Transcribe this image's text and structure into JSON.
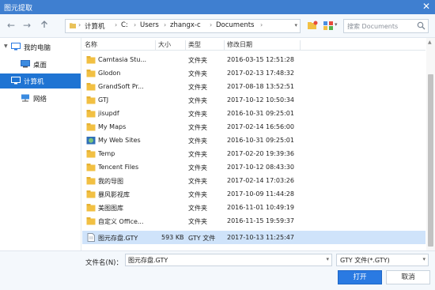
{
  "window": {
    "title": "图元提取",
    "close_label": "✕"
  },
  "address_bar": {
    "crumbs": [
      "计算机",
      "C:",
      "Users",
      "zhangx-c",
      "Documents"
    ]
  },
  "search": {
    "placeholder": "搜索 Documents"
  },
  "sidebar": {
    "items": [
      {
        "label": "我的电脑",
        "icon": "monitor-icon"
      },
      {
        "label": "桌面",
        "icon": "desktop-icon"
      },
      {
        "label": "计算机",
        "icon": "computer-icon"
      },
      {
        "label": "网络",
        "icon": "network-icon"
      }
    ]
  },
  "file_list": {
    "columns": [
      "名称",
      "大小",
      "类型",
      "修改日期"
    ],
    "rows": [
      {
        "name": "Camtasia Stu...",
        "size": "",
        "type": "文件夹",
        "modified": "2016-03-15 12:51:28",
        "icon": "folder-icon"
      },
      {
        "name": "Glodon",
        "size": "",
        "type": "文件夹",
        "modified": "2017-02-13 17:48:32",
        "icon": "folder-icon"
      },
      {
        "name": "GrandSoft Pr...",
        "size": "",
        "type": "文件夹",
        "modified": "2017-08-18 13:52:51",
        "icon": "folder-icon"
      },
      {
        "name": "GTJ",
        "size": "",
        "type": "文件夹",
        "modified": "2017-10-12 10:50:34",
        "icon": "folder-icon"
      },
      {
        "name": "jisupdf",
        "size": "",
        "type": "文件夹",
        "modified": "2016-10-31 09:25:01",
        "icon": "folder-icon"
      },
      {
        "name": "My Maps",
        "size": "",
        "type": "文件夹",
        "modified": "2017-02-14 16:56:00",
        "icon": "folder-icon"
      },
      {
        "name": "My Web Sites",
        "size": "",
        "type": "文件夹",
        "modified": "2016-10-31 09:25:01",
        "icon": "web-sites-folder-icon"
      },
      {
        "name": "Temp",
        "size": "",
        "type": "文件夹",
        "modified": "2017-02-20 19:39:36",
        "icon": "folder-icon"
      },
      {
        "name": "Tencent Files",
        "size": "",
        "type": "文件夹",
        "modified": "2017-10-12 08:43:30",
        "icon": "folder-icon"
      },
      {
        "name": "我的导图",
        "size": "",
        "type": "文件夹",
        "modified": "2017-02-14 17:03:26",
        "icon": "folder-icon"
      },
      {
        "name": "暴风影视库",
        "size": "",
        "type": "文件夹",
        "modified": "2017-10-09 11:44:28",
        "icon": "folder-icon"
      },
      {
        "name": "美图图库",
        "size": "",
        "type": "文件夹",
        "modified": "2016-11-01 10:49:19",
        "icon": "folder-icon"
      },
      {
        "name": "自定义 Office...",
        "size": "",
        "type": "文件夹",
        "modified": "2016-11-15 19:59:37",
        "icon": "folder-icon"
      },
      {
        "name": "图元存盘.GTY",
        "size": "593 KB",
        "type": "GTY 文件",
        "modified": "2017-10-13 11:25:47",
        "icon": "file-icon",
        "selected": true
      }
    ]
  },
  "bottom": {
    "filename_label": "文件名(N)：",
    "filename_value": "图元存盘.GTY",
    "filetype_value": "GTY 文件(*.GTY)",
    "open_label": "打开",
    "cancel_label": "取消"
  },
  "colors": {
    "title_bar": "#3f7fd0",
    "selection": "#1f74d3",
    "row_selected": "#cfe3fa",
    "folder": "#f2c043"
  }
}
